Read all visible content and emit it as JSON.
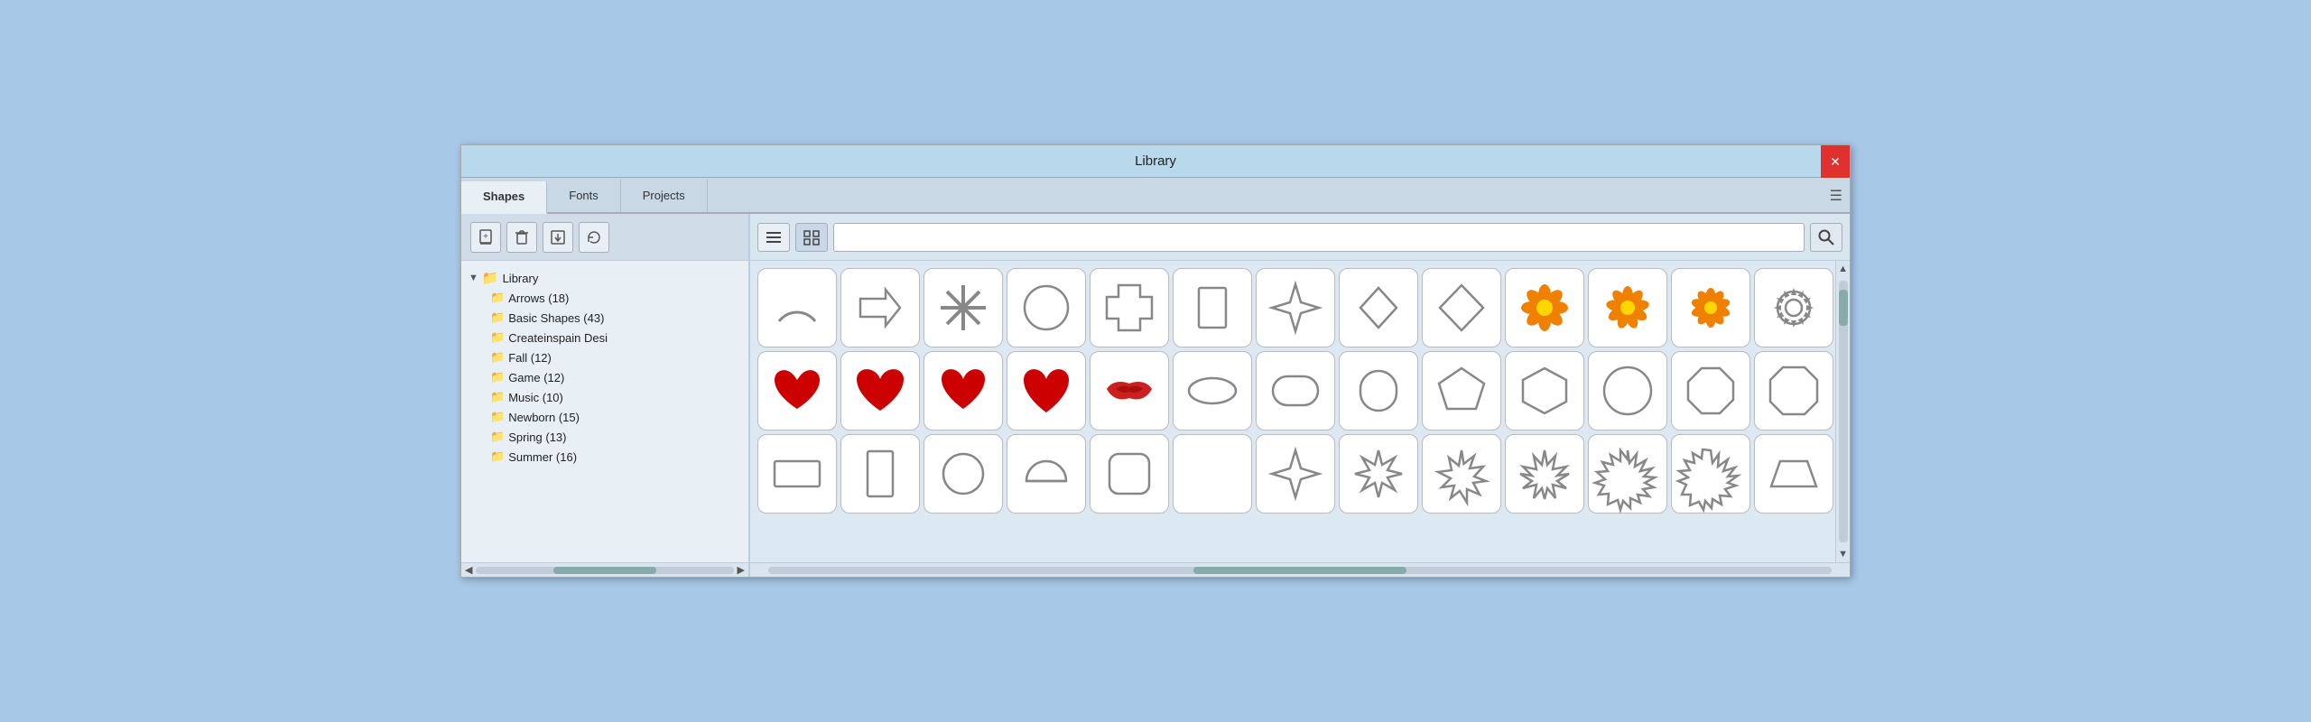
{
  "window": {
    "title": "Library",
    "close_label": "✕"
  },
  "tabs": [
    {
      "label": "Shapes",
      "active": true
    },
    {
      "label": "Fonts",
      "active": false
    },
    {
      "label": "Projects",
      "active": false
    }
  ],
  "tab_menu_icon": "☰",
  "sidebar": {
    "toolbar_buttons": [
      {
        "icon": "➕",
        "name": "add-button"
      },
      {
        "icon": "🗑",
        "name": "delete-button"
      },
      {
        "icon": "📥",
        "name": "import-button"
      },
      {
        "icon": "🔄",
        "name": "refresh-button"
      }
    ],
    "tree": {
      "root_label": "Library",
      "items": [
        {
          "label": "Arrows (18)"
        },
        {
          "label": "Basic Shapes (43)"
        },
        {
          "label": "Createinspain Desi"
        },
        {
          "label": "Fall (12)"
        },
        {
          "label": "Game (12)"
        },
        {
          "label": "Music (10)"
        },
        {
          "label": "Newborn (15)"
        },
        {
          "label": "Spring (13)"
        },
        {
          "label": "Summer (16)"
        }
      ]
    }
  },
  "main": {
    "view_list_icon": "☰",
    "view_grid_icon": "⊞",
    "search_placeholder": "",
    "search_icon": "🔍"
  },
  "shapes": {
    "rows": [
      [
        "arc",
        "arrow-right",
        "asterisk",
        "circle",
        "cross",
        "rectangle-tall",
        "4star",
        "diamond-sm",
        "diamond-lg",
        "flower-orange1",
        "flower-orange2",
        "flower-orange3",
        "gear",
        "empty"
      ],
      [
        "heart1",
        "heart2",
        "heart3",
        "heart4",
        "lips",
        "oval",
        "rounded-rect1",
        "rounded-rect2",
        "pentagon",
        "hexagon",
        "circle-lg",
        "octagon-sm",
        "octagon-lg",
        "empty"
      ],
      [
        "rect-landscape",
        "rect-portrait",
        "circle-outline",
        "half-circle",
        "rounded-square",
        "empty2",
        "star4-outline",
        "star6",
        "star7",
        "star8",
        "star9",
        "star10",
        "trapezoid",
        "empty"
      ]
    ]
  }
}
